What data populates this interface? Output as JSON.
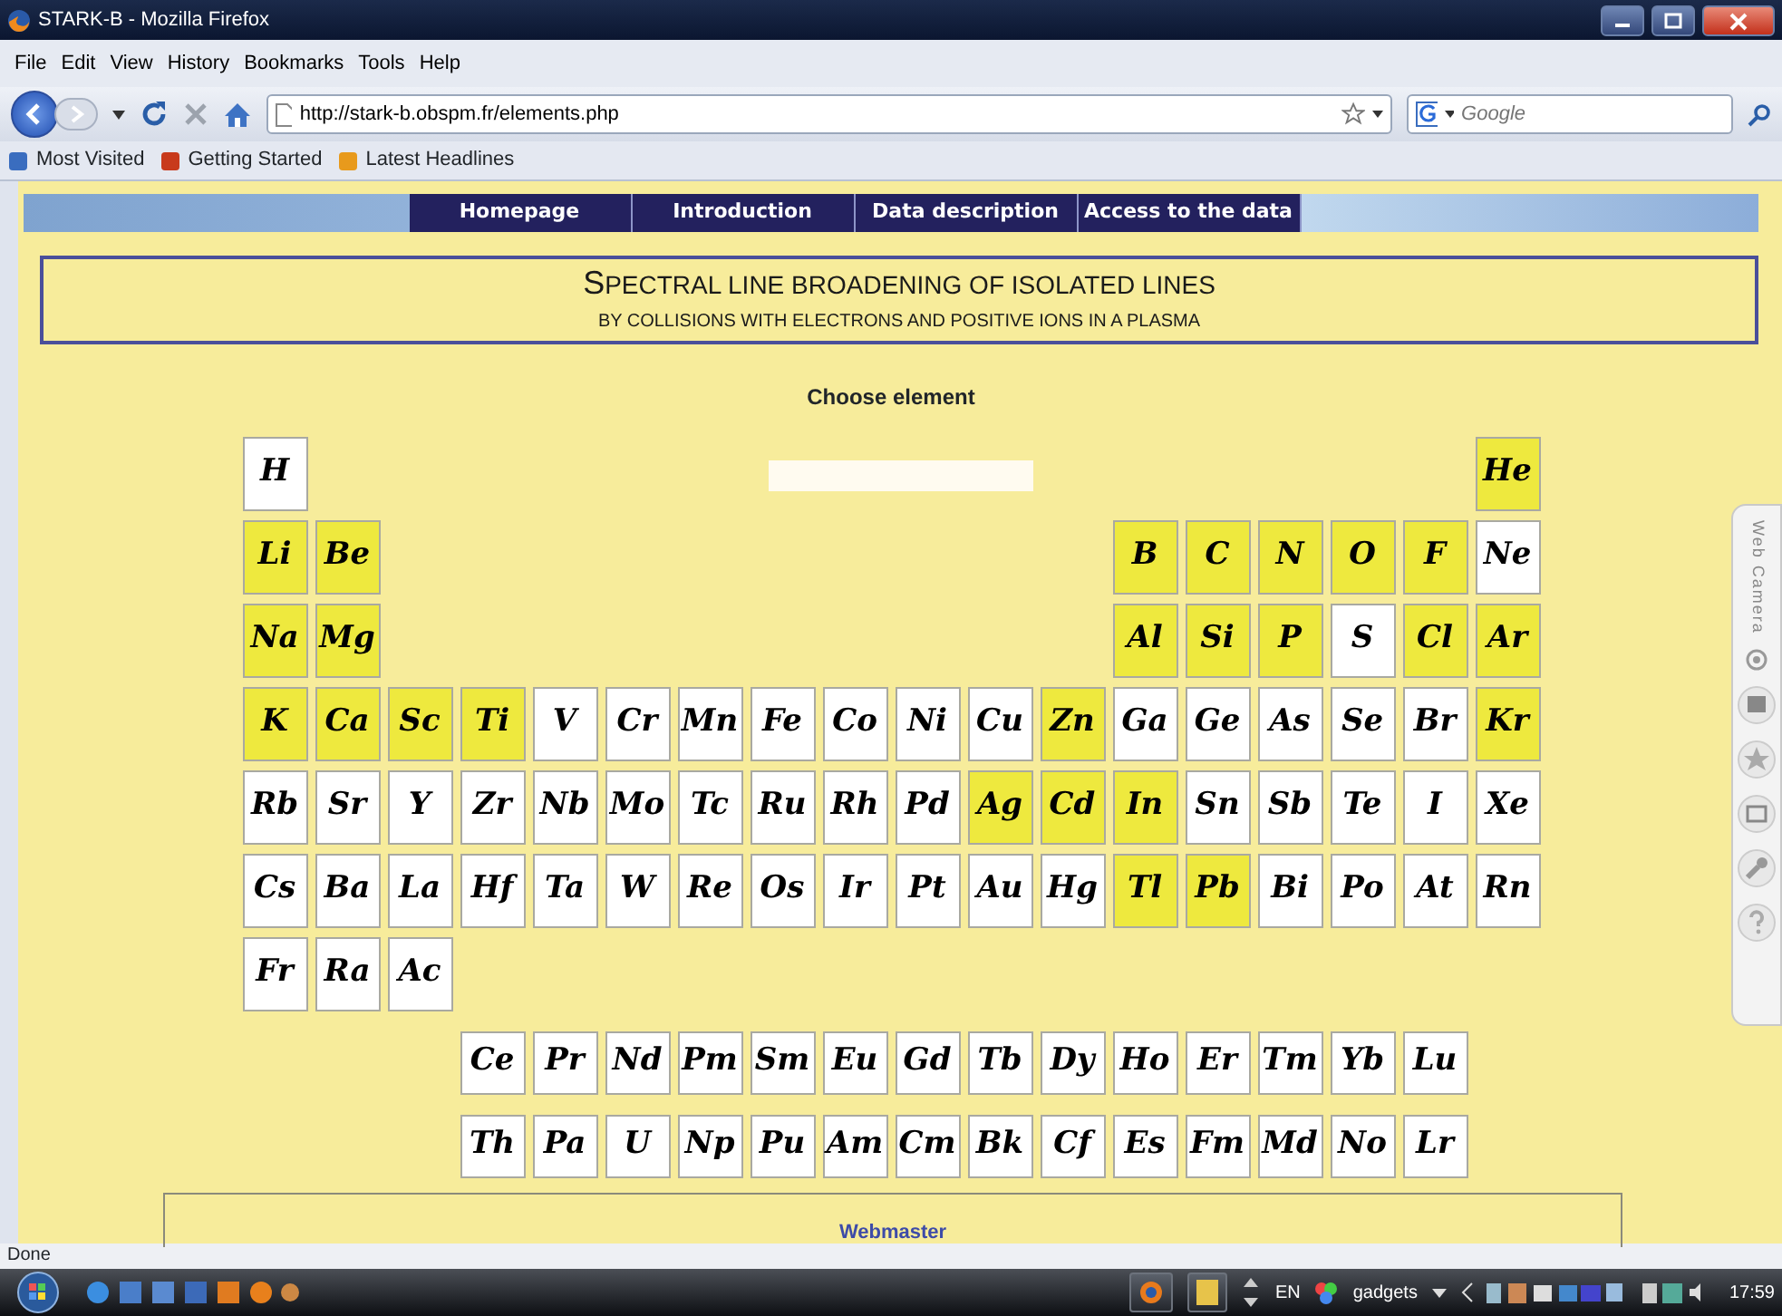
{
  "window": {
    "title": "STARK-B - Mozilla Firefox"
  },
  "menu": [
    "File",
    "Edit",
    "View",
    "History",
    "Bookmarks",
    "Tools",
    "Help"
  ],
  "address": {
    "value": "http://stark-b.obspm.fr/elements.php"
  },
  "search": {
    "placeholder": "Google"
  },
  "bookmarks": [
    "Most Visited",
    "Getting Started",
    "Latest Headlines"
  ],
  "site_nav": [
    "Homepage",
    "Introduction",
    "Data description",
    "Access to the data"
  ],
  "heading": {
    "title": "SPECTRAL LINE BROADENING OF ISOLATED LINES",
    "subtitle": "BY COLLISIONS WITH ELECTRONS AND POSITIVE IONS IN A PLASMA"
  },
  "prompt": "Choose element",
  "table": {
    "rows": [
      {
        "left": [
          {
            "symbol": "H",
            "has_data": false
          }
        ],
        "right": [
          {
            "symbol": "He",
            "has_data": true
          }
        ]
      },
      {
        "left": [
          {
            "symbol": "Li",
            "has_data": true
          },
          {
            "symbol": "Be",
            "has_data": true
          }
        ],
        "right": [
          {
            "symbol": "B",
            "has_data": true
          },
          {
            "symbol": "C",
            "has_data": true
          },
          {
            "symbol": "N",
            "has_data": true
          },
          {
            "symbol": "O",
            "has_data": true
          },
          {
            "symbol": "F",
            "has_data": true
          },
          {
            "symbol": "Ne",
            "has_data": false
          }
        ]
      },
      {
        "left": [
          {
            "symbol": "Na",
            "has_data": true
          },
          {
            "symbol": "Mg",
            "has_data": true
          }
        ],
        "right": [
          {
            "symbol": "Al",
            "has_data": true
          },
          {
            "symbol": "Si",
            "has_data": true
          },
          {
            "symbol": "P",
            "has_data": true
          },
          {
            "symbol": "S",
            "has_data": false
          },
          {
            "symbol": "Cl",
            "has_data": true
          },
          {
            "symbol": "Ar",
            "has_data": true
          }
        ]
      },
      {
        "left": [
          {
            "symbol": "K",
            "has_data": true
          },
          {
            "symbol": "Ca",
            "has_data": true
          },
          {
            "symbol": "Sc",
            "has_data": true
          },
          {
            "symbol": "Ti",
            "has_data": true
          },
          {
            "symbol": "V",
            "has_data": false
          },
          {
            "symbol": "Cr",
            "has_data": false
          },
          {
            "symbol": "Mn",
            "has_data": false
          },
          {
            "symbol": "Fe",
            "has_data": false
          },
          {
            "symbol": "Co",
            "has_data": false
          },
          {
            "symbol": "Ni",
            "has_data": false
          },
          {
            "symbol": "Cu",
            "has_data": false
          },
          {
            "symbol": "Zn",
            "has_data": true
          },
          {
            "symbol": "Ga",
            "has_data": false
          },
          {
            "symbol": "Ge",
            "has_data": false
          },
          {
            "symbol": "As",
            "has_data": false
          },
          {
            "symbol": "Se",
            "has_data": false
          },
          {
            "symbol": "Br",
            "has_data": false
          },
          {
            "symbol": "Kr",
            "has_data": true
          }
        ],
        "right": []
      },
      {
        "left": [
          {
            "symbol": "Rb",
            "has_data": false
          },
          {
            "symbol": "Sr",
            "has_data": false
          },
          {
            "symbol": "Y",
            "has_data": false
          },
          {
            "symbol": "Zr",
            "has_data": false
          },
          {
            "symbol": "Nb",
            "has_data": false
          },
          {
            "symbol": "Mo",
            "has_data": false
          },
          {
            "symbol": "Tc",
            "has_data": false
          },
          {
            "symbol": "Ru",
            "has_data": false
          },
          {
            "symbol": "Rh",
            "has_data": false
          },
          {
            "symbol": "Pd",
            "has_data": false
          },
          {
            "symbol": "Ag",
            "has_data": true
          },
          {
            "symbol": "Cd",
            "has_data": true
          },
          {
            "symbol": "In",
            "has_data": true
          },
          {
            "symbol": "Sn",
            "has_data": false
          },
          {
            "symbol": "Sb",
            "has_data": false
          },
          {
            "symbol": "Te",
            "has_data": false
          },
          {
            "symbol": "I",
            "has_data": false
          },
          {
            "symbol": "Xe",
            "has_data": false
          }
        ],
        "right": []
      },
      {
        "left": [
          {
            "symbol": "Cs",
            "has_data": false
          },
          {
            "symbol": "Ba",
            "has_data": false
          },
          {
            "symbol": "La",
            "has_data": false
          },
          {
            "symbol": "Hf",
            "has_data": false
          },
          {
            "symbol": "Ta",
            "has_data": false
          },
          {
            "symbol": "W",
            "has_data": false
          },
          {
            "symbol": "Re",
            "has_data": false
          },
          {
            "symbol": "Os",
            "has_data": false
          },
          {
            "symbol": "Ir",
            "has_data": false
          },
          {
            "symbol": "Pt",
            "has_data": false
          },
          {
            "symbol": "Au",
            "has_data": false
          },
          {
            "symbol": "Hg",
            "has_data": false
          },
          {
            "symbol": "Tl",
            "has_data": true
          },
          {
            "symbol": "Pb",
            "has_data": true
          },
          {
            "symbol": "Bi",
            "has_data": false
          },
          {
            "symbol": "Po",
            "has_data": false
          },
          {
            "symbol": "At",
            "has_data": false
          },
          {
            "symbol": "Rn",
            "has_data": false
          }
        ],
        "right": []
      },
      {
        "left": [
          {
            "symbol": "Fr",
            "has_data": false
          },
          {
            "symbol": "Ra",
            "has_data": false
          },
          {
            "symbol": "Ac",
            "has_data": false
          }
        ],
        "right": []
      }
    ],
    "f_block": [
      [
        {
          "symbol": "Ce",
          "has_data": false
        },
        {
          "symbol": "Pr",
          "has_data": false
        },
        {
          "symbol": "Nd",
          "has_data": false
        },
        {
          "symbol": "Pm",
          "has_data": false
        },
        {
          "symbol": "Sm",
          "has_data": false
        },
        {
          "symbol": "Eu",
          "has_data": false
        },
        {
          "symbol": "Gd",
          "has_data": false
        },
        {
          "symbol": "Tb",
          "has_data": false
        },
        {
          "symbol": "Dy",
          "has_data": false
        },
        {
          "symbol": "Ho",
          "has_data": false
        },
        {
          "symbol": "Er",
          "has_data": false
        },
        {
          "symbol": "Tm",
          "has_data": false
        },
        {
          "symbol": "Yb",
          "has_data": false
        },
        {
          "symbol": "Lu",
          "has_data": false
        }
      ],
      [
        {
          "symbol": "Th",
          "has_data": false
        },
        {
          "symbol": "Pa",
          "has_data": false
        },
        {
          "symbol": "U",
          "has_data": false
        },
        {
          "symbol": "Np",
          "has_data": false
        },
        {
          "symbol": "Pu",
          "has_data": false
        },
        {
          "symbol": "Am",
          "has_data": false
        },
        {
          "symbol": "Cm",
          "has_data": false
        },
        {
          "symbol": "Bk",
          "has_data": false
        },
        {
          "symbol": "Cf",
          "has_data": false
        },
        {
          "symbol": "Es",
          "has_data": false
        },
        {
          "symbol": "Fm",
          "has_data": false
        },
        {
          "symbol": "Md",
          "has_data": false
        },
        {
          "symbol": "No",
          "has_data": false
        },
        {
          "symbol": "Lr",
          "has_data": false
        }
      ]
    ]
  },
  "footer": {
    "link": "Webmaster"
  },
  "gadget_sidebar": {
    "title": "Web Camera"
  },
  "status_bar": "Done",
  "taskbar": {
    "language": "EN",
    "toolbar": "gadgets",
    "clock": "17:59"
  }
}
